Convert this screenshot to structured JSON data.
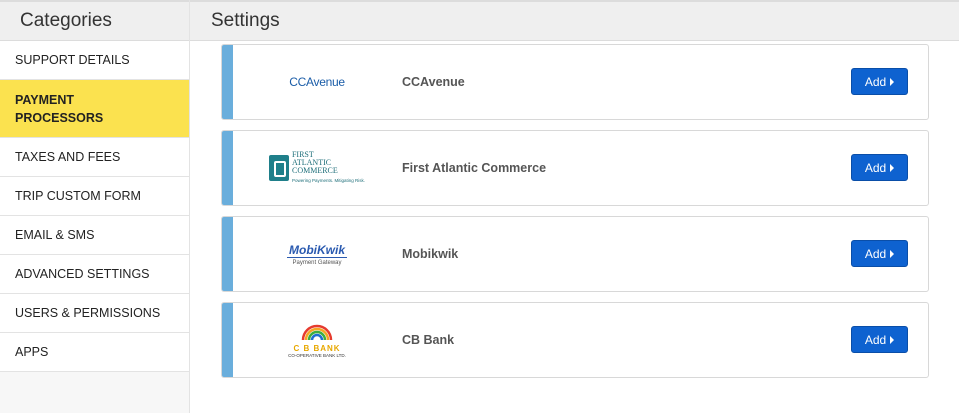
{
  "sidebar": {
    "title": "Categories",
    "items": [
      {
        "label": "SUPPORT DETAILS"
      },
      {
        "label": "PAYMENT PROCESSORS"
      },
      {
        "label": "TAXES AND FEES"
      },
      {
        "label": "TRIP CUSTOM FORM"
      },
      {
        "label": "EMAIL & SMS"
      },
      {
        "label": "ADVANCED SETTINGS"
      },
      {
        "label": "USERS & PERMISSIONS"
      },
      {
        "label": "APPS"
      }
    ]
  },
  "main": {
    "title": "Settings",
    "processors": [
      {
        "name": "CCAvenue",
        "logo_text": "CCAvenue",
        "add_label": "Add"
      },
      {
        "name": "First Atlantic Commerce",
        "logo_line1": "FIRST",
        "logo_line2": "ATLANTIC",
        "logo_line3": "COMMERCE",
        "logo_tagline": "Powering Payments. Mitigating Risk.",
        "add_label": "Add"
      },
      {
        "name": "Mobikwik",
        "logo_text": "MobiKwik",
        "logo_sub": "Payment Gateway",
        "add_label": "Add"
      },
      {
        "name": "CB Bank",
        "logo_text": "C B  BANK",
        "logo_sub": "CO-OPERATIVE BANK LTD.",
        "add_label": "Add"
      }
    ]
  },
  "colors": {
    "active_item": "#fbe24f",
    "accent_bar": "#6aaedc",
    "button": "#0e62d0"
  }
}
